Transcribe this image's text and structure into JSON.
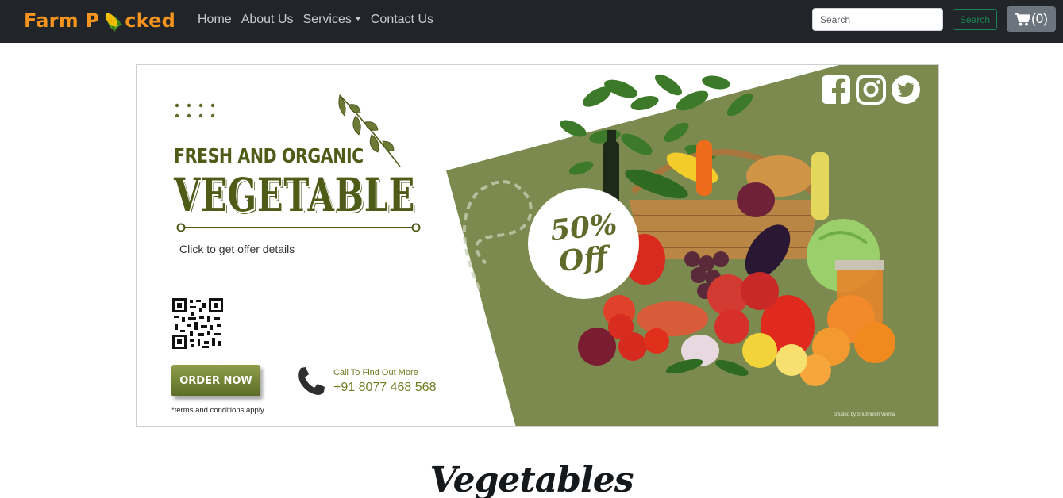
{
  "navbar": {
    "brand": {
      "prefix": "Farm P",
      "suffix": "cked",
      "icon": "corn-icon",
      "color": "#f7941d"
    },
    "links": [
      {
        "label": "Home"
      },
      {
        "label": "About Us"
      },
      {
        "label": "Services",
        "dropdown": true
      },
      {
        "label": "Contact Us"
      }
    ],
    "search": {
      "placeholder": "Search",
      "value": ""
    },
    "search_button": "Search",
    "cart": {
      "icon": "cart-icon",
      "label": "(0)"
    }
  },
  "banner": {
    "subtitle": "FRESH AND ORGANIC",
    "title": "VEGETABLE",
    "offer_link": "Click to get offer details",
    "order_button": "ORDER NOW",
    "call_label": "Call To Find Out More",
    "phone": "+91 8077 468 568",
    "terms": "*terms and conditions apply",
    "discount": {
      "percent": "50%",
      "word": "Off"
    },
    "credit": "created by Shubhnish Verma",
    "social_icons": [
      "facebook-icon",
      "instagram-icon",
      "twitter-icon"
    ],
    "accent_color": "#7d8a4f",
    "text_color": "#4e5c18"
  },
  "section": {
    "heading": "Vegetables"
  }
}
